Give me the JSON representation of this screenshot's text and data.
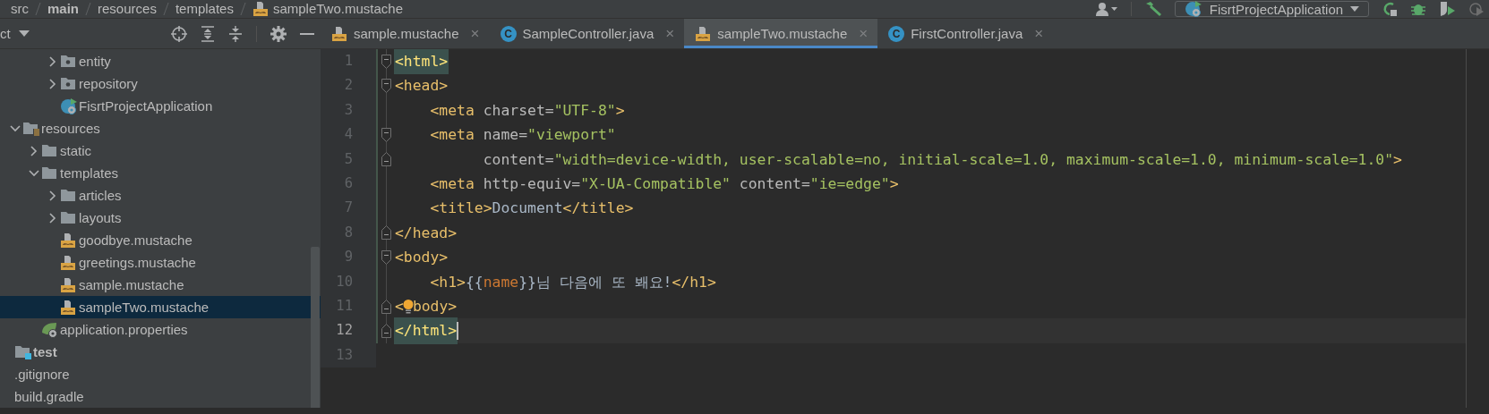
{
  "breadcrumb": [
    {
      "label": "src",
      "kind": "folder"
    },
    {
      "label": "main",
      "kind": "module"
    },
    {
      "label": "resources",
      "kind": "folder"
    },
    {
      "label": "templates",
      "kind": "folder"
    },
    {
      "label": "sampleTwo.mustache",
      "kind": "mustache"
    }
  ],
  "run_config": {
    "label": "FisrtProjectApplication"
  },
  "project_panel": {
    "title": "ct",
    "tree": [
      {
        "children": [
          {
            "children": [
              {
                "children": [
                  {
                    "label": "entity",
                    "kind": "package",
                    "expanded": false,
                    "selected": false
                  },
                  {
                    "label": "repository",
                    "kind": "package",
                    "expanded": false,
                    "selected": false
                  },
                  {
                    "label": "FisrtProjectApplication",
                    "kind": "spring-app",
                    "selected": false
                  }
                ]
              }
            ]
          },
          {
            "label": "resources",
            "kind": "resource-root",
            "expanded": true,
            "selected": false,
            "children": [
              {
                "label": "static",
                "kind": "folder",
                "expanded": false,
                "selected": false
              },
              {
                "label": "templates",
                "kind": "folder",
                "expanded": true,
                "selected": false,
                "children": [
                  {
                    "label": "articles",
                    "kind": "folder",
                    "expanded": false,
                    "selected": false
                  },
                  {
                    "label": "layouts",
                    "kind": "folder",
                    "expanded": false,
                    "selected": false
                  },
                  {
                    "label": "goodbye.mustache",
                    "kind": "mustache",
                    "selected": false
                  },
                  {
                    "label": "greetings.mustache",
                    "kind": "mustache",
                    "selected": false
                  },
                  {
                    "label": "sample.mustache",
                    "kind": "mustache",
                    "selected": false
                  },
                  {
                    "label": "sampleTwo.mustache",
                    "kind": "mustache",
                    "selected": true
                  }
                ]
              },
              {
                "label": "application.properties",
                "kind": "properties",
                "selected": false
              }
            ]
          }
        ]
      },
      {
        "label": "test",
        "kind": "test-root",
        "selected": false
      },
      {
        "label": ".gitignore",
        "kind": "plain",
        "selected": false
      },
      {
        "label": "build.gradle",
        "kind": "plain",
        "selected": false
      }
    ]
  },
  "tabs": [
    {
      "label": "sample.mustache",
      "kind": "mustache",
      "close": "×",
      "selected": false
    },
    {
      "label": "SampleController.java",
      "kind": "java",
      "badge": "C",
      "close": "×",
      "selected": false
    },
    {
      "label": "sampleTwo.mustache",
      "kind": "mustache",
      "close": "×",
      "selected": true
    },
    {
      "label": "FirstController.java",
      "kind": "java",
      "badge": "C",
      "close": "×",
      "selected": false
    }
  ],
  "lines": [
    {
      "number": "1",
      "kind": "fold-start",
      "current": false,
      "tag_highlight": true,
      "tokens": [
        {
          "kind": "tag",
          "text": "<html>"
        }
      ]
    },
    {
      "number": "2",
      "kind": "fold-start",
      "current": false,
      "tag_highlight": false,
      "tokens": [
        {
          "kind": "tag",
          "text": "<head>"
        }
      ]
    },
    {
      "number": "3",
      "kind": "plain",
      "current": false,
      "tag_highlight": false,
      "tokens": [
        {
          "kind": "tag",
          "text": "    <meta"
        },
        {
          "kind": "attr",
          "text": " charset="
        },
        {
          "kind": "value",
          "text": "\"UTF-8\""
        },
        {
          "kind": "tag",
          "text": ">"
        }
      ]
    },
    {
      "number": "4",
      "kind": "fold-start",
      "current": false,
      "tag_highlight": false,
      "tokens": [
        {
          "kind": "tag",
          "text": "    <meta"
        },
        {
          "kind": "attr",
          "text": " name="
        },
        {
          "kind": "value",
          "text": "\"viewport\""
        }
      ]
    },
    {
      "number": "5",
      "kind": "fold-end",
      "current": false,
      "tag_highlight": false,
      "tokens": [
        {
          "kind": "attr",
          "text": "          content="
        },
        {
          "kind": "value",
          "text": "\"width=device-width, user-scalable=no, initial-scale=1.0, maximum-scale=1.0, minimum-scale=1.0\""
        },
        {
          "kind": "tag",
          "text": ">"
        }
      ]
    },
    {
      "number": "6",
      "kind": "plain",
      "current": false,
      "tag_highlight": false,
      "tokens": [
        {
          "kind": "tag",
          "text": "    <meta"
        },
        {
          "kind": "attr",
          "text": " http-equiv="
        },
        {
          "kind": "value",
          "text": "\"X-UA-Compatible\""
        },
        {
          "kind": "attr",
          "text": " content="
        },
        {
          "kind": "value",
          "text": "\"ie=edge\""
        },
        {
          "kind": "tag",
          "text": ">"
        }
      ]
    },
    {
      "number": "7",
      "kind": "plain",
      "current": false,
      "tag_highlight": false,
      "tokens": [
        {
          "kind": "tag",
          "text": "    <title>"
        },
        {
          "kind": "text",
          "text": "Document"
        },
        {
          "kind": "tag",
          "text": "</title>"
        }
      ]
    },
    {
      "number": "8",
      "kind": "fold-end",
      "current": false,
      "tag_highlight": false,
      "tokens": [
        {
          "kind": "tag",
          "text": "</head>"
        }
      ]
    },
    {
      "number": "9",
      "kind": "fold-start",
      "current": false,
      "tag_highlight": false,
      "tokens": [
        {
          "kind": "tag",
          "text": "<body>"
        }
      ]
    },
    {
      "number": "10",
      "kind": "plain",
      "current": false,
      "tag_highlight": false,
      "tokens": [
        {
          "kind": "tag",
          "text": "    <h1>"
        },
        {
          "kind": "text",
          "text": "{{"
        },
        {
          "kind": "var",
          "text": "name"
        },
        {
          "kind": "text",
          "text": "}}님 다음에 또 봬요!"
        },
        {
          "kind": "tag",
          "text": "</h1>"
        }
      ]
    },
    {
      "number": "11",
      "kind": "fold-end",
      "current": false,
      "tag_highlight": false,
      "tokens": [
        {
          "kind": "tag",
          "text": "<"
        },
        {
          "kind": "bulb"
        },
        {
          "kind": "tag",
          "text": "body>"
        }
      ]
    },
    {
      "number": "12",
      "kind": "fold-end",
      "current": true,
      "tag_highlight": true,
      "tokens": [
        {
          "kind": "tag",
          "text": "</html>"
        }
      ]
    },
    {
      "number": "13",
      "kind": "plain",
      "current": false
    }
  ]
}
